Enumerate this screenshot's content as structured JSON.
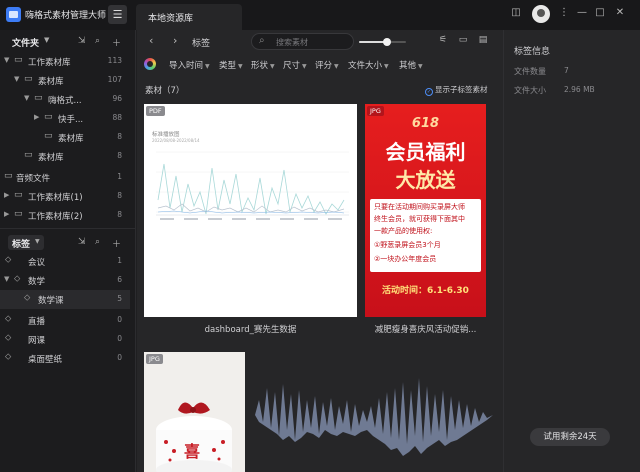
{
  "app": {
    "title": "嗨格式素材管理大师",
    "tab": "本地资源库"
  },
  "colors": {
    "accent": "#3d7cf5",
    "poster_red": "#e61e1e",
    "poster_yellow": "#ffe27a"
  },
  "sidebar": {
    "folders_title": "文件夹",
    "folders": [
      {
        "label": "工作素材库",
        "count": "113"
      },
      {
        "label": "素材库",
        "count": "107"
      },
      {
        "label": "嗨格式...",
        "count": "96"
      },
      {
        "label": "快手...",
        "count": "88"
      },
      {
        "label": "素材库",
        "count": "8"
      },
      {
        "label": "素材库",
        "count": "8"
      },
      {
        "label": "音频文件",
        "count": "1"
      },
      {
        "label": "工作素材库(1)",
        "count": "8"
      },
      {
        "label": "工作素材库(2)",
        "count": "8"
      }
    ],
    "tags_title": "标签",
    "tags": [
      {
        "label": "会议",
        "count": "1"
      },
      {
        "label": "数学",
        "count": "6"
      },
      {
        "label": "数学课",
        "count": "5"
      },
      {
        "label": "直播",
        "count": "0"
      },
      {
        "label": "网课",
        "count": "0"
      },
      {
        "label": "桌面壁纸",
        "count": "0"
      }
    ]
  },
  "toolbar": {
    "breadcrumb": "标签",
    "search_placeholder": "搜索素材",
    "zoom_level": 0.6
  },
  "filters": [
    {
      "label": "导入时间"
    },
    {
      "label": "类型"
    },
    {
      "label": "形状"
    },
    {
      "label": "尺寸"
    },
    {
      "label": "评分"
    },
    {
      "label": "文件大小"
    },
    {
      "label": "其他"
    }
  ],
  "content": {
    "count_label": "素材（7）",
    "show_sub_tags": "显示子标签素材",
    "items": [
      {
        "badge": "PDF",
        "name": "dashboard_赛先生数据"
      },
      {
        "badge": "JPG",
        "name": "减肥瘦身喜庆风活动促销..."
      },
      {
        "badge": "JPG",
        "name": ""
      }
    ],
    "dashboard_thumb": {
      "title": "标准播放图",
      "subtitle": "2022/08/08-2022/08/14"
    },
    "poster": {
      "line1": "618",
      "line2": "会员福利",
      "line3": "大放送",
      "body": [
        "只要在活动期间购买录屏大师",
        "终生会员，就可获得下面其中",
        "一款产品的使用权:",
        "①野葱录屏会员3个月",
        "②一块办公年度会员"
      ],
      "period": "活动时间：6.1-6.30"
    },
    "cake_text": "喜"
  },
  "info_panel": {
    "title": "标签信息",
    "rows": [
      {
        "key": "文件数量",
        "value": "7"
      },
      {
        "key": "文件大小",
        "value": "2.96 MB"
      }
    ],
    "trial": "试用剩余24天"
  }
}
